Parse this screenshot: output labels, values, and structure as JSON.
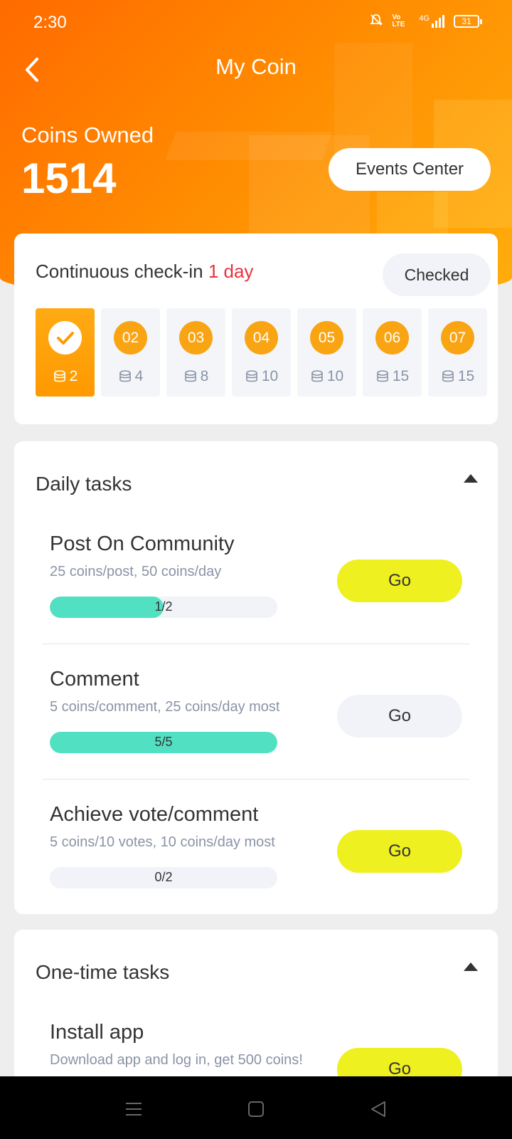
{
  "status_bar": {
    "time": "2:30",
    "volte": "Vo LTE",
    "network": "4G",
    "battery": "31"
  },
  "header": {
    "title": "My Coin",
    "coins_label": "Coins Owned",
    "coins_value": "1514",
    "events_button": "Events Center"
  },
  "checkin": {
    "title_prefix": "Continuous check-in",
    "title_highlight": "1 day",
    "status_button": "Checked",
    "days": [
      {
        "label": "",
        "reward": "2",
        "checked": true
      },
      {
        "label": "02",
        "reward": "4",
        "checked": false
      },
      {
        "label": "03",
        "reward": "8",
        "checked": false
      },
      {
        "label": "04",
        "reward": "10",
        "checked": false
      },
      {
        "label": "05",
        "reward": "10",
        "checked": false
      },
      {
        "label": "06",
        "reward": "15",
        "checked": false
      },
      {
        "label": "07",
        "reward": "15",
        "checked": false
      }
    ]
  },
  "daily_tasks": {
    "title": "Daily tasks",
    "tasks": [
      {
        "title": "Post On Community",
        "desc": "25 coins/post, 50 coins/day",
        "progress_text": "1/2",
        "progress": 0.5,
        "button": "Go",
        "button_style": "yellow"
      },
      {
        "title": "Comment",
        "desc": "5 coins/comment, 25 coins/day most",
        "progress_text": "5/5",
        "progress": 1.0,
        "button": "Go",
        "button_style": "grey"
      },
      {
        "title": "Achieve vote/comment",
        "desc": "5 coins/10 votes, 10 coins/day most",
        "progress_text": "0/2",
        "progress": 0.0,
        "button": "Go",
        "button_style": "yellow"
      }
    ]
  },
  "one_time_tasks": {
    "title": "One-time tasks",
    "tasks": [
      {
        "title": "Install app",
        "desc": "Download app and log in, get 500 coins!",
        "button": "Go",
        "button_style": "yellow"
      }
    ]
  },
  "colors": {
    "accent": "#ff8a00",
    "highlight": "#e8333c",
    "go_yellow": "#eef01f",
    "progress": "#52e0c2"
  },
  "icons": [
    "back-chevron-icon",
    "mute-icon",
    "signal-icon",
    "battery-icon",
    "check-icon",
    "coin-stack-icon",
    "collapse-triangle-icon",
    "menu-icon",
    "home-icon",
    "back-nav-icon"
  ]
}
